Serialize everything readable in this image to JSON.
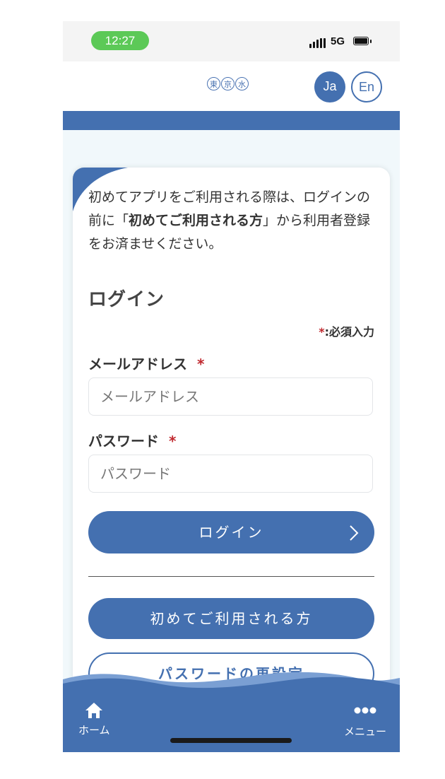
{
  "status_bar": {
    "time": "12:27",
    "network": "5G"
  },
  "header": {
    "logo_chars": [
      "東",
      "京",
      "水"
    ],
    "lang_ja": "Ja",
    "lang_en": "En"
  },
  "intro": {
    "text_before": "初めてアプリをご利用される際は、ログインの前に「",
    "text_bold": "初めてご利用される方",
    "text_after": "」から利用者登録をお済ませください。"
  },
  "login": {
    "title": "ログイン",
    "required_star": "*",
    "required_note": ":必須入力",
    "email_label": "メールアドレス",
    "email_placeholder": "メールアドレス",
    "email_value": "",
    "password_label": "パスワード",
    "password_placeholder": "パスワード",
    "password_value": "",
    "login_button": "ログイン",
    "first_time_button": "初めてご利用される方",
    "reset_button": "パスワードの再設定"
  },
  "bottom_nav": {
    "home_label": "ホーム",
    "menu_label": "メニュー"
  },
  "colors": {
    "primary": "#4470b0",
    "time_pill": "#5cc957",
    "required": "#c0282e",
    "background": "#f1f8fb"
  },
  "icons": {
    "home": "home-icon",
    "menu": "more-horizontal-icon",
    "chevron": "chevron-right-icon"
  }
}
